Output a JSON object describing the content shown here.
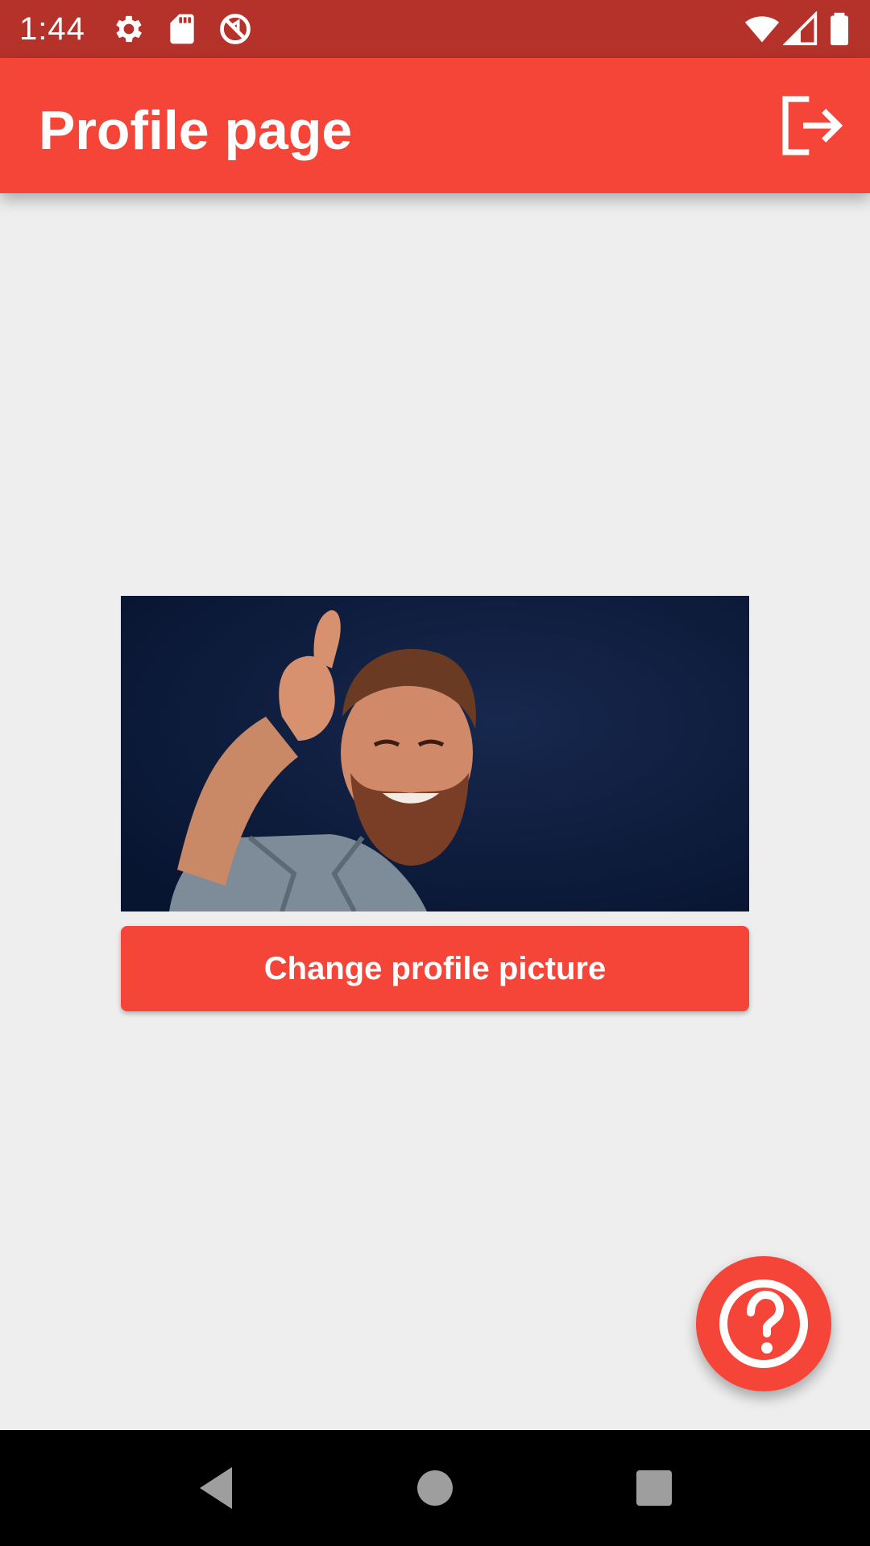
{
  "status_bar": {
    "time": "1:44",
    "icons": [
      "settings-icon",
      "sd-card-icon",
      "blocked-icon",
      "wifi-icon",
      "signal-icon",
      "battery-icon"
    ],
    "background": "#b5322a"
  },
  "app_bar": {
    "title": "Profile page",
    "action_icon": "logout-icon",
    "background": "#f44538"
  },
  "profile": {
    "picture_alt": "profile-photo",
    "change_button_label": "Change profile picture"
  },
  "fab": {
    "icon": "help-icon"
  },
  "nav_bar": {
    "buttons": [
      "back-icon",
      "home-icon",
      "recents-icon"
    ]
  },
  "colors": {
    "accent": "#f44538",
    "page_background": "#eeeeee"
  }
}
